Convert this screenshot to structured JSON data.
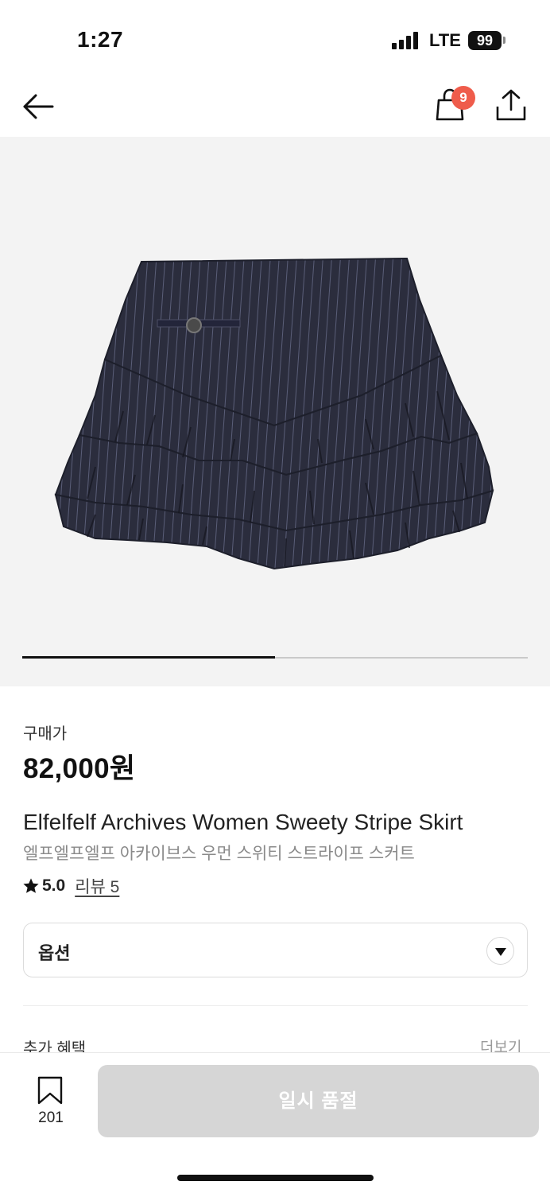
{
  "status_bar": {
    "time": "1:27",
    "network": "LTE",
    "battery": "99"
  },
  "nav": {
    "back_icon": "arrow-left-icon",
    "cart_icon": "shopping-bag-icon",
    "cart_badge": "9",
    "share_icon": "share-upload-icon"
  },
  "carousel": {
    "progress": 0.5
  },
  "product": {
    "price_label": "구매가",
    "price": "82,000원",
    "title_en": "Elfelfelf Archives Women Sweety Stripe Skirt",
    "title_ko": "엘프엘프엘프 아카이브스 우먼 스위티 스트라이프 스커트",
    "rating": "5.0",
    "review_link": "리뷰 5"
  },
  "options": {
    "label": "옵션"
  },
  "benefits": {
    "label": "추가 혜택",
    "more": "더보기"
  },
  "bottom_bar": {
    "wish_count": "201",
    "soldout_label": "일시 품절"
  },
  "colors": {
    "badge": "#ef5c4b",
    "button_disabled": "#d6d6d6",
    "image_bg": "#f3f3f3"
  }
}
